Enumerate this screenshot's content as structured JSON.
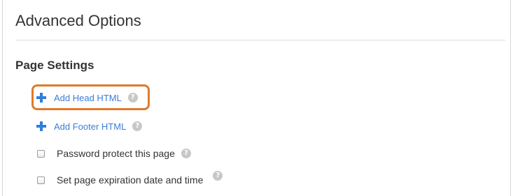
{
  "panel": {
    "title": "Advanced Options",
    "section_title": "Page Settings"
  },
  "options": {
    "add_head_html": {
      "label": "Add Head HTML",
      "help": "?"
    },
    "add_footer_html": {
      "label": "Add Footer HTML",
      "help": "?"
    },
    "password_protect": {
      "label": "Password protect this page",
      "checked": false,
      "help": "?"
    },
    "page_expiration": {
      "label": "Set page expiration date and time",
      "checked": false,
      "help": "?"
    }
  },
  "colors": {
    "link": "#3b7dd8",
    "plus_icon": "#2f7fd6",
    "highlight": "#e07a2a",
    "help_icon": "#c8c8c8"
  },
  "icons": [
    "plus-icon",
    "help-icon",
    "checkbox"
  ]
}
